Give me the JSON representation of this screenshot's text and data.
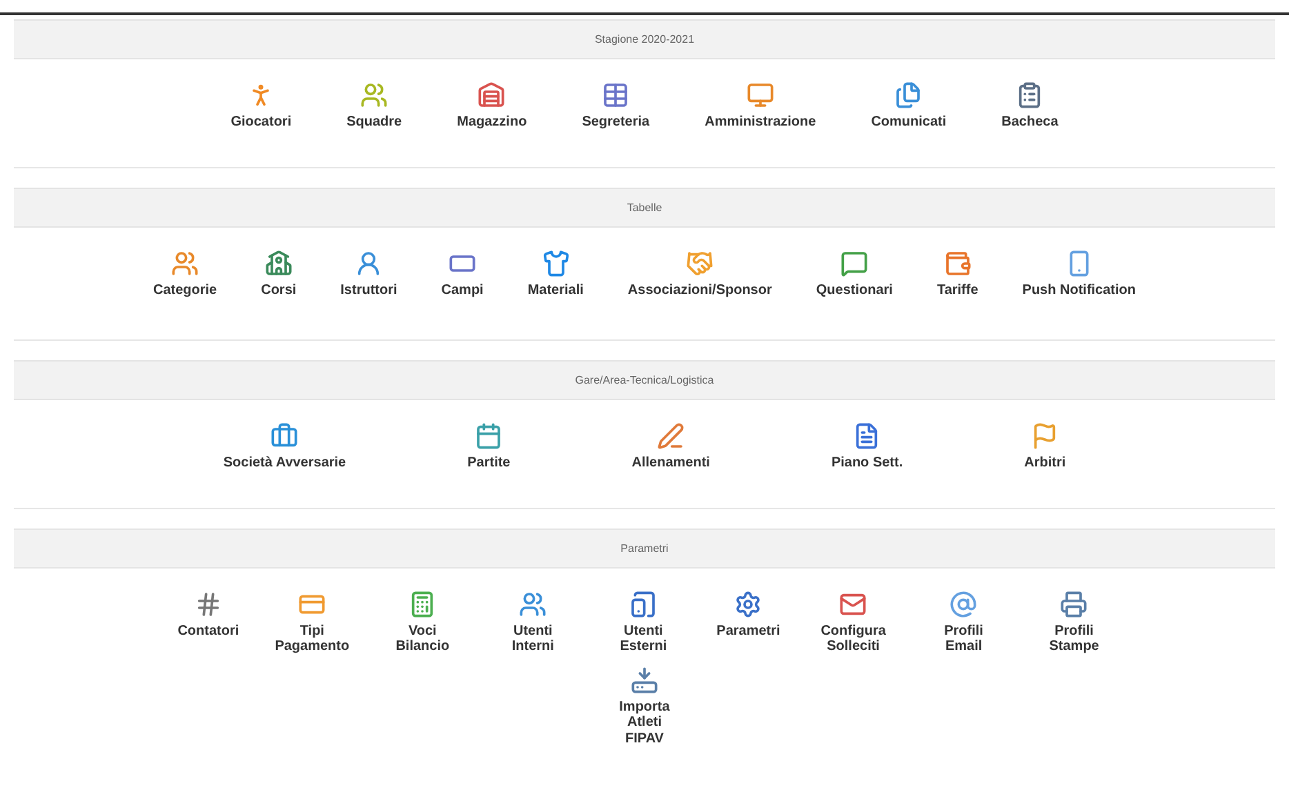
{
  "sections": [
    {
      "title": "Stagione 2020-2021",
      "items": [
        {
          "label": "Giocatori"
        },
        {
          "label": "Squadre"
        },
        {
          "label": "Magazzino"
        },
        {
          "label": "Segreteria"
        },
        {
          "label": "Amministrazione"
        },
        {
          "label": "Comunicati"
        },
        {
          "label": "Bacheca"
        }
      ]
    },
    {
      "title": "Tabelle",
      "items": [
        {
          "label": "Categorie"
        },
        {
          "label": "Corsi"
        },
        {
          "label": "Istruttori"
        },
        {
          "label": "Campi"
        },
        {
          "label": "Materiali"
        },
        {
          "label": "Associazioni/Sponsor"
        },
        {
          "label": "Questionari"
        },
        {
          "label": "Tariffe"
        },
        {
          "label": "Push Notification"
        }
      ]
    },
    {
      "title": "Gare/Area-Tecnica/Logistica",
      "items": [
        {
          "label": "Società Avversarie"
        },
        {
          "label": "Partite"
        },
        {
          "label": "Allenamenti"
        },
        {
          "label": "Piano Sett."
        },
        {
          "label": "Arbitri"
        }
      ]
    },
    {
      "title": "Parametri",
      "items": [
        {
          "label": "Contatori"
        },
        {
          "label": "Tipi Pagamento"
        },
        {
          "label": "Voci Bilancio"
        },
        {
          "label": "Utenti Interni"
        },
        {
          "label": "Utenti Esterni"
        },
        {
          "label": "Parametri"
        },
        {
          "label": "Configura Solleciti"
        },
        {
          "label": "Profili Email"
        },
        {
          "label": "Profili Stampe"
        },
        {
          "label": "Importa Atleti FIPAV"
        }
      ]
    }
  ]
}
